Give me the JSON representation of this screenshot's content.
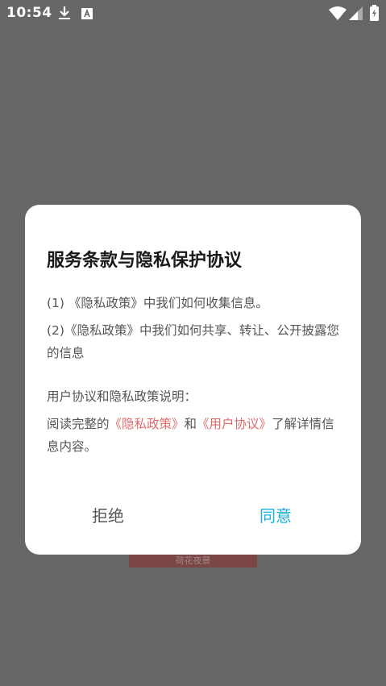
{
  "status_bar": {
    "time": "10:54",
    "icons": [
      "download-icon",
      "text-app-icon",
      "wifi-icon",
      "signal-icon",
      "battery-charging-icon"
    ]
  },
  "background": {
    "banner_text": "荷花夜景"
  },
  "dialog": {
    "title": "服务条款与隐私保护协议",
    "item1": "(1) 《隐私政策》中我们如何收集信息。",
    "item2": "(2)《隐私政策》中我们如何共享、转让、公开披露您的信息",
    "explanation_heading": "用户协议和隐私政策说明：",
    "read_prefix": "阅读完整的",
    "privacy_link": "《隐私政策》",
    "and_text": "和",
    "user_agreement_link": "《用户协议》",
    "read_suffix": "了解详情信息内容。",
    "reject_label": "拒绝",
    "agree_label": "同意"
  },
  "colors": {
    "overlay": "#666666",
    "link": "#e06b6b",
    "accent": "#1ab1e0"
  }
}
